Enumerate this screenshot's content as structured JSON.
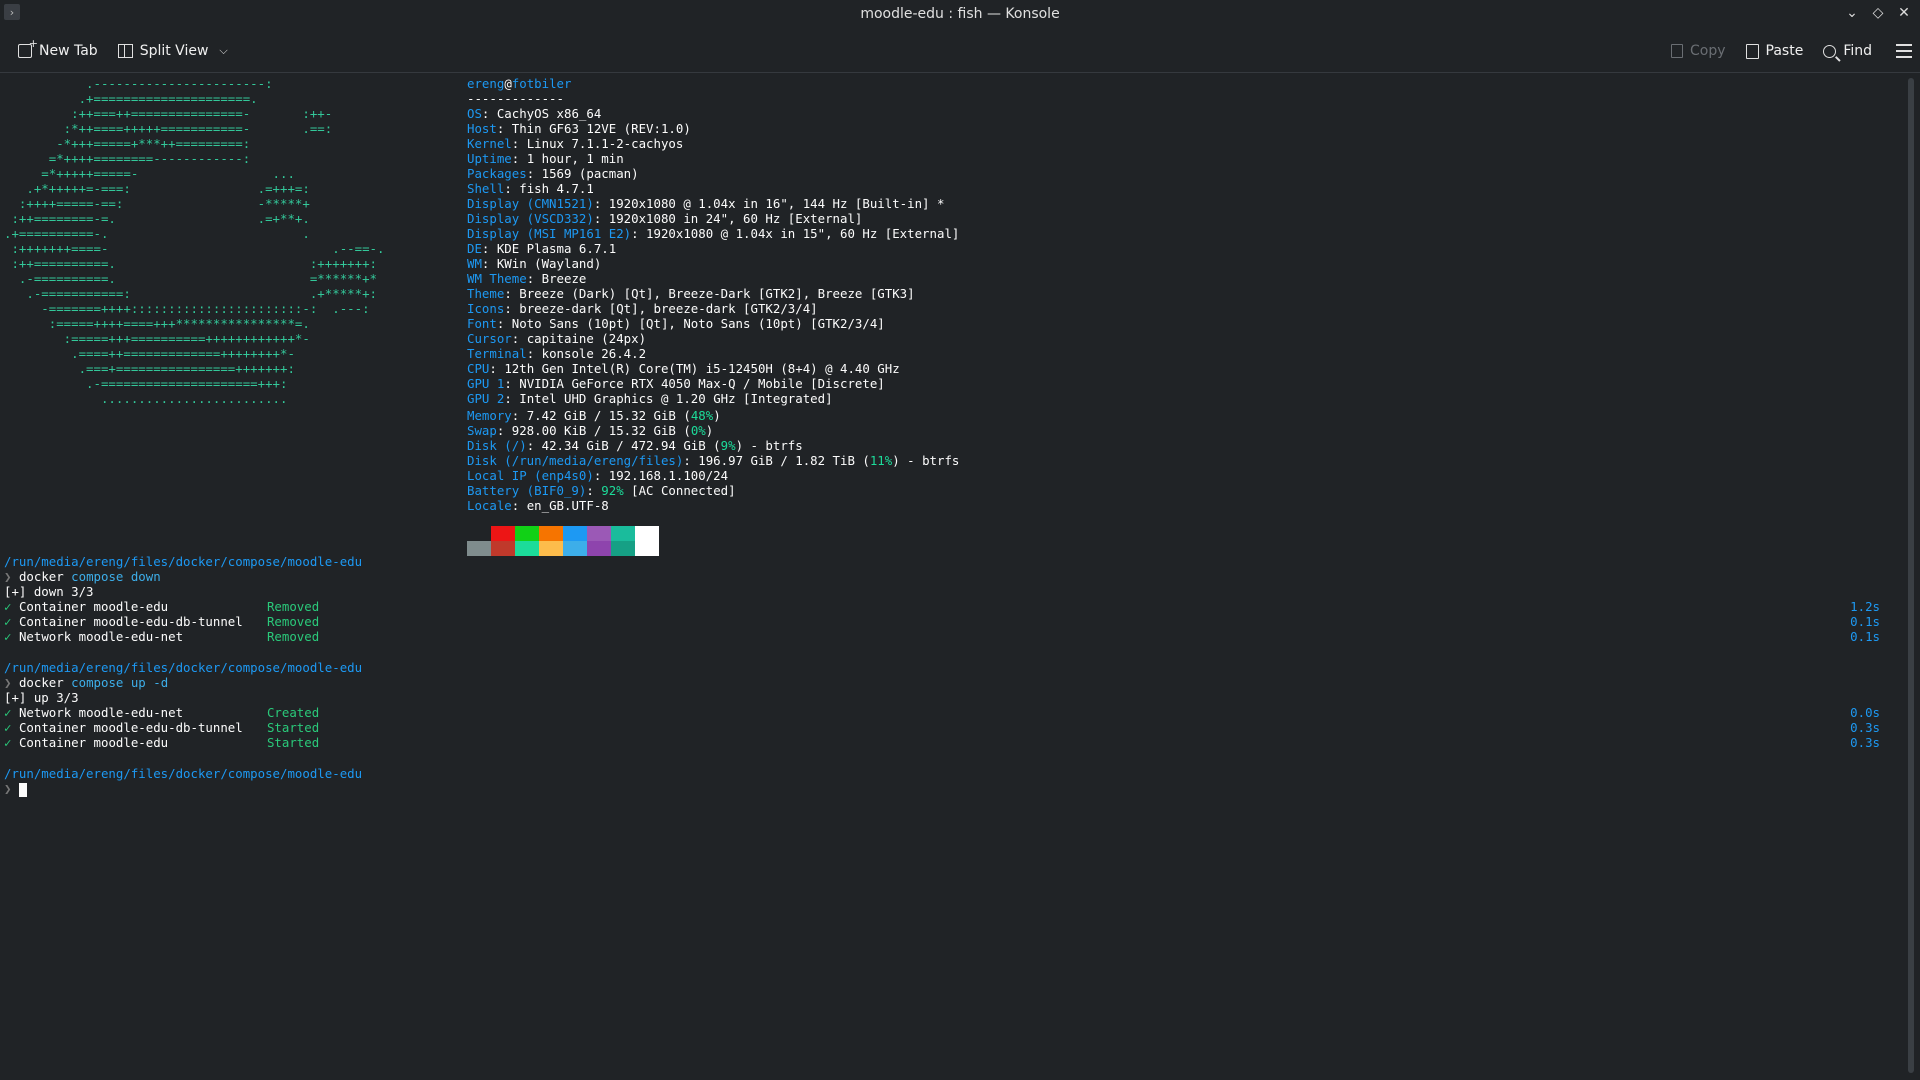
{
  "window": {
    "title": "moodle-edu : fish — Konsole",
    "app_icon": "terminal-icon"
  },
  "toolbar": {
    "new_tab": "New Tab",
    "split_view": "Split View",
    "copy": "Copy",
    "paste": "Paste",
    "find": "Find"
  },
  "ascii_art": [
    "           .-----------------------:",
    "          .+=====================.",
    "         :++===++===============-       :++-",
    "        :*++====+++++===========-       .==:",
    "       -*+++=====+***++=========:",
    "      =*++++========------------:",
    "     =*+++++=====-                  ...",
    "   .+*+++++=-===:                 .=+++=:",
    "  :++++=====-==:                  -*****+",
    " :++========-=.                   .=+**+.",
    ".+==========-.                          .",
    " :+++++++====-                              .--==-.",
    " :++==========.                          :+++++++:",
    "  .-==========.                          =******+*",
    "   .-===========:                        .+*****+:",
    "     -=======++++:::::::::::::::::::::::-:  .---:",
    "      :=====++++====+++****************=.",
    "        :=====+++==========++++++++++++*-",
    "         .====++=============++++++++*-",
    "          .===+================+++++++:",
    "           .-=====================+++:",
    "             ........................."
  ],
  "fastfetch": {
    "user": "ereng",
    "host_name": "fotbiler",
    "separator": "-------------",
    "rows": [
      {
        "key": "OS",
        "value": "CachyOS x86_64"
      },
      {
        "key": "Host",
        "value": "Thin GF63 12VE (REV:1.0)"
      },
      {
        "key": "Kernel",
        "value": "Linux 7.1.1-2-cachyos"
      },
      {
        "key": "Uptime",
        "value": "1 hour, 1 min"
      },
      {
        "key": "Packages",
        "value": "1569 (pacman)"
      },
      {
        "key": "Shell",
        "value": "fish 4.7.1"
      },
      {
        "key": "Display (CMN1521)",
        "value": "1920x1080 @ 1.04x in 16\", 144 Hz [Built-in] *"
      },
      {
        "key": "Display (VSCD332)",
        "value": "1920x1080 in 24\", 60 Hz [External]"
      },
      {
        "key": "Display (MSI MP161 E2)",
        "value": "1920x1080 @ 1.04x in 15\", 60 Hz [External]"
      },
      {
        "key": "DE",
        "value": "KDE Plasma 6.7.1"
      },
      {
        "key": "WM",
        "value": "KWin (Wayland)"
      },
      {
        "key": "WM Theme",
        "value": "Breeze"
      },
      {
        "key": "Theme",
        "value": "Breeze (Dark) [Qt], Breeze-Dark [GTK2], Breeze [GTK3]"
      },
      {
        "key": "Icons",
        "value": "breeze-dark [Qt], breeze-dark [GTK2/3/4]"
      },
      {
        "key": "Font",
        "value": "Noto Sans (10pt) [Qt], Noto Sans (10pt) [GTK2/3/4]"
      },
      {
        "key": "Cursor",
        "value": "capitaine (24px)"
      },
      {
        "key": "Terminal",
        "value": "konsole 26.4.2"
      },
      {
        "key": "CPU",
        "value": "12th Gen Intel(R) Core(TM) i5-12450H (8+4) @ 4.40 GHz"
      },
      {
        "key": "GPU 1",
        "value": "NVIDIA GeForce RTX 4050 Max-Q / Mobile [Discrete]"
      },
      {
        "key": "GPU 2",
        "value": "Intel UHD Graphics @ 1.20 GHz [Integrated]"
      }
    ],
    "memory": {
      "key": "Memory",
      "pre": "7.42 GiB / 15.32 GiB (",
      "pct": "48%",
      "post": ")"
    },
    "swap": {
      "key": "Swap",
      "pre": "928.00 KiB / 15.32 GiB (",
      "pct": "0%",
      "post": ")"
    },
    "disk1": {
      "key": "Disk (/)",
      "pre": "42.34 GiB / 472.94 GiB (",
      "pct": "9%",
      "post": ") - btrfs"
    },
    "disk2": {
      "key": "Disk (/run/media/ereng/files)",
      "pre": "196.97 GiB / 1.82 TiB (",
      "pct": "11%",
      "post": ") - btrfs"
    },
    "local_ip": {
      "key": "Local IP (enp4s0)",
      "value": "192.168.1.100/24"
    },
    "battery": {
      "key": "Battery (BIF0_9)",
      "pct": "92%",
      "post": " [AC Connected]"
    },
    "locale": {
      "key": "Locale",
      "value": "en_GB.UTF-8"
    }
  },
  "palette_colors": {
    "top": [
      "#202326",
      "#ed1515",
      "#11d116",
      "#f67400",
      "#1d99f3",
      "#9b59b6",
      "#1abc9c",
      "#ffffff"
    ],
    "bottom": [
      "#7f8c8d",
      "#c0392b",
      "#1cdc9a",
      "#fdbc4b",
      "#3daee9",
      "#8e44ad",
      "#16a085",
      "#ffffff"
    ]
  },
  "session": {
    "path": "/run/media/ereng/files/docker/compose/moodle-edu",
    "cmd1": {
      "base": "docker",
      "args": "compose down"
    },
    "down_header": "[+] down 3/3",
    "down_rows": [
      {
        "name": "Container moodle-edu",
        "status": "Removed",
        "time": "1.2s"
      },
      {
        "name": "Container moodle-edu-db-tunnel",
        "status": "Removed",
        "time": "0.1s"
      },
      {
        "name": "Network moodle-edu-net",
        "status": "Removed",
        "time": "0.1s"
      }
    ],
    "cmd2": {
      "base": "docker",
      "args": "compose up -d"
    },
    "up_header": "[+] up 3/3",
    "up_rows": [
      {
        "name": "Network moodle-edu-net",
        "status": "Created",
        "time": "0.0s"
      },
      {
        "name": "Container moodle-edu-db-tunnel",
        "status": "Started",
        "time": "0.3s"
      },
      {
        "name": "Container moodle-edu",
        "status": "Started",
        "time": "0.3s"
      }
    ],
    "check": "✓",
    "prompt_char": "❯"
  }
}
